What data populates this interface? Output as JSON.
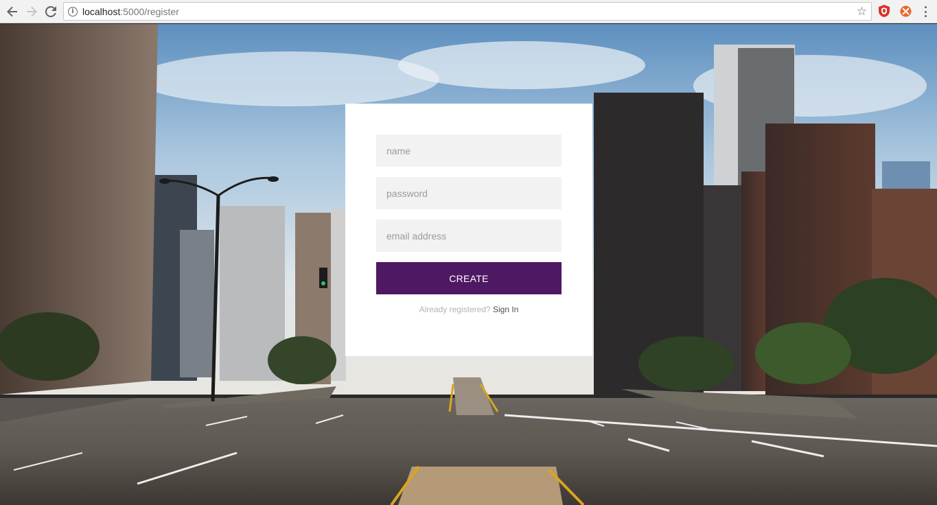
{
  "browser": {
    "url_host": "localhost",
    "url_path": ":5000/register"
  },
  "form": {
    "name_placeholder": "name",
    "password_placeholder": "password",
    "email_placeholder": "email address",
    "create_label": "CREATE",
    "registered_question": "Already registered?",
    "sign_in_label": "Sign In"
  },
  "colors": {
    "button": "#4f1863",
    "field_bg": "#f2f2f2"
  },
  "icons": {
    "back": "back-arrow-icon",
    "forward": "forward-arrow-icon",
    "reload": "reload-icon",
    "info": "info-icon",
    "bookmark": "star-icon",
    "extension_1": "shield-icon",
    "extension_2": "ball-icon",
    "menu": "kebab-menu-icon"
  }
}
